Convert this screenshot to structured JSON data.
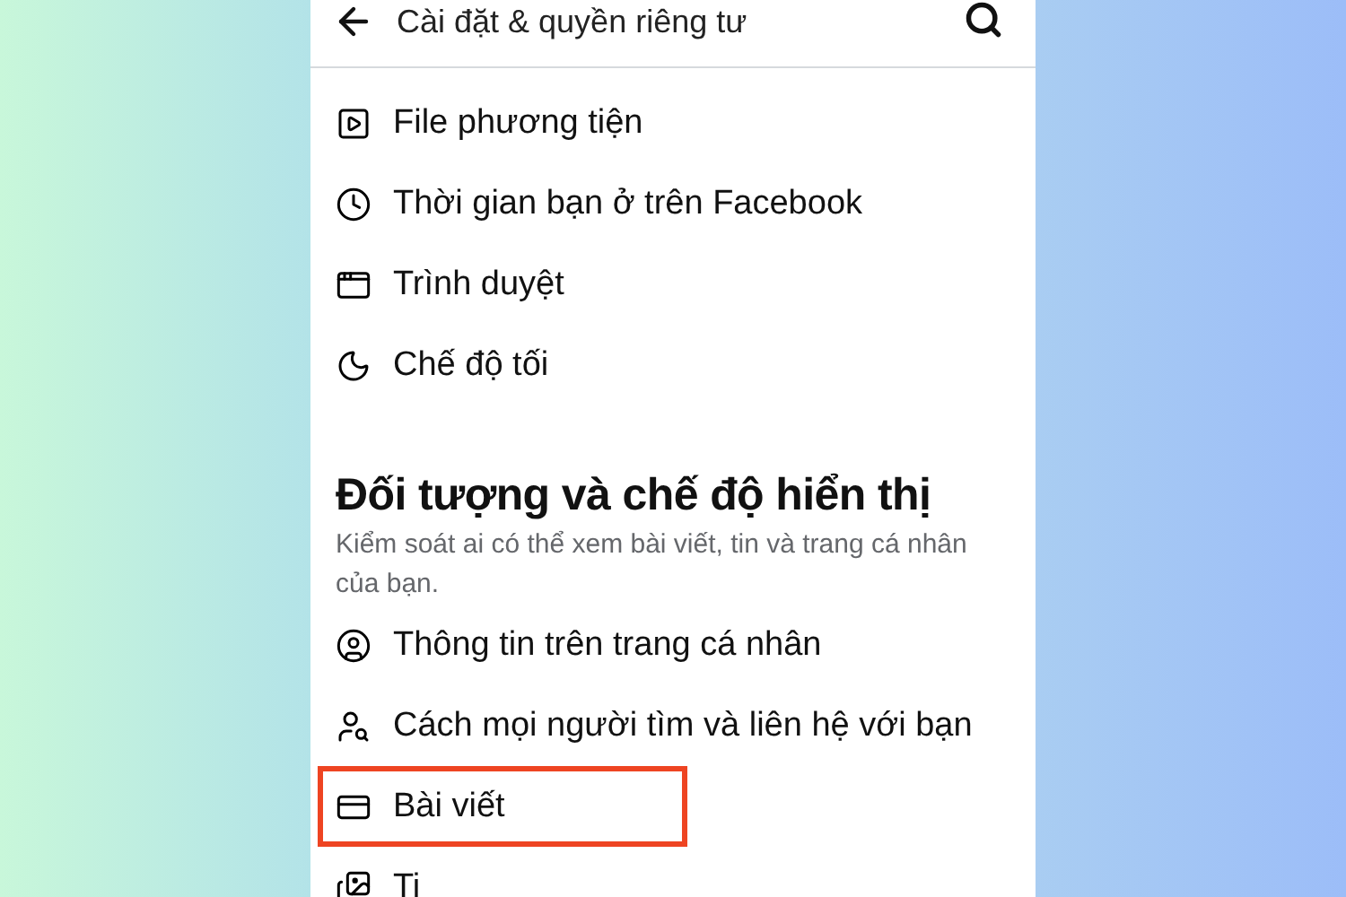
{
  "header": {
    "title": "Cài đặt & quyền riêng tư"
  },
  "top_items": [
    {
      "label": "File phương tiện",
      "highlighted": false
    },
    {
      "label": "Thời gian bạn ở trên Facebook",
      "highlighted": false
    },
    {
      "label": "Trình duyệt",
      "highlighted": false
    },
    {
      "label": "Chế độ tối",
      "highlighted": false
    }
  ],
  "section": {
    "title": "Đối tượng và chế độ hiển thị",
    "description": "Kiểm soát ai có thể xem bài viết, tin và trang cá nhân của bạn."
  },
  "section_items": [
    {
      "label": "Thông tin trên trang cá nhân",
      "highlighted": false
    },
    {
      "label": "Cách mọi người tìm và liên hệ với bạn",
      "highlighted": false
    },
    {
      "label": "Bài viết",
      "highlighted": true
    },
    {
      "label": "Ti",
      "highlighted": false
    }
  ]
}
